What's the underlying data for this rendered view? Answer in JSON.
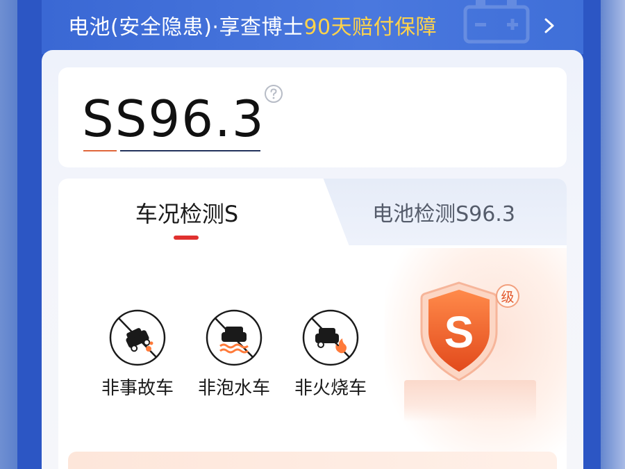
{
  "banner": {
    "text_main": "电池(安全隐患)·享查博士",
    "text_highlight": "90天赔付保障",
    "chevron_icon": "chevron-right-icon"
  },
  "score": {
    "value": "SS96.3",
    "help_icon": "question-circle-icon"
  },
  "tabs": [
    {
      "label": "车况检测S",
      "active": true
    },
    {
      "label": "电池检测S96.3",
      "active": false
    }
  ],
  "badges": [
    {
      "label": "非事故车",
      "icon": "no-accident-icon"
    },
    {
      "label": "非泡水车",
      "icon": "no-flood-icon"
    },
    {
      "label": "非火烧车",
      "icon": "no-fire-icon"
    }
  ],
  "grade": {
    "letter": "S",
    "suffix": "级"
  },
  "colors": {
    "accent_red": "#e0312f",
    "highlight_yellow": "#ffd34a",
    "banner_blue": "#3a68d4",
    "shield_orange": "#f06a2a"
  }
}
